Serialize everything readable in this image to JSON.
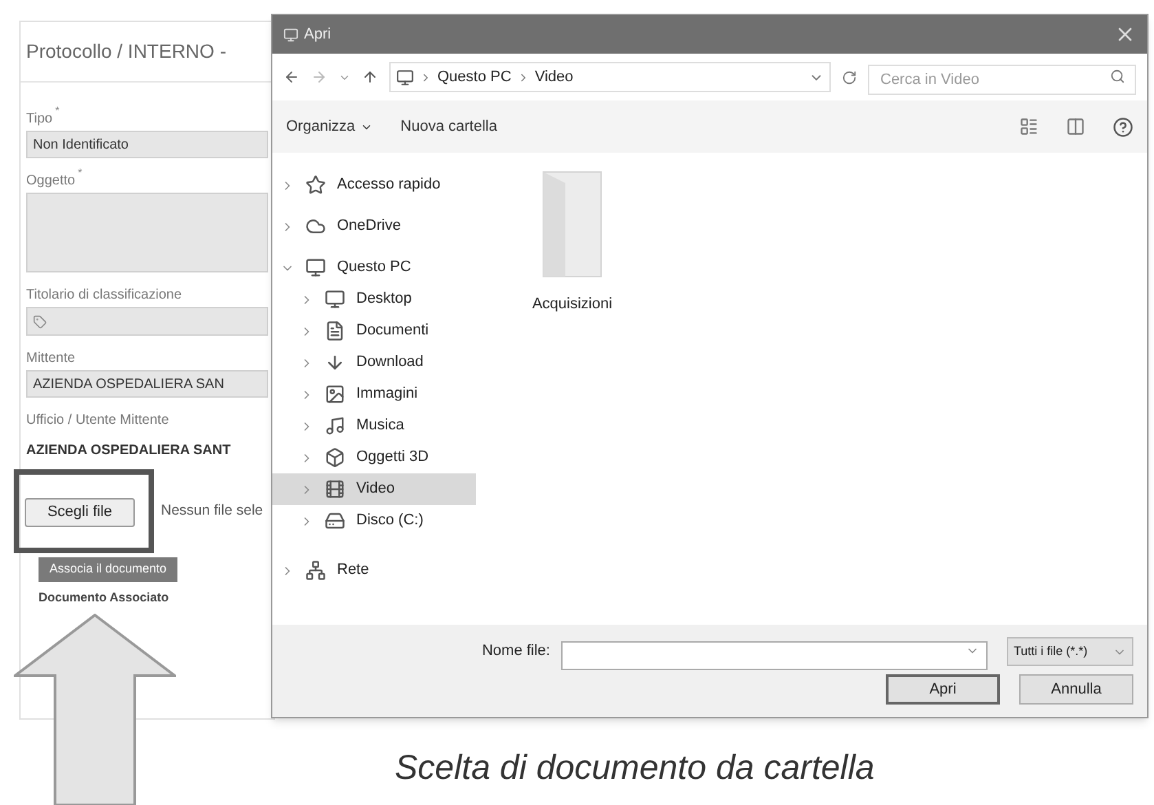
{
  "form": {
    "title": "Protocollo / INTERNO -",
    "fields": [
      {
        "label": "Tipo",
        "marker": "*",
        "kind": "select",
        "value": "Non Identificato"
      },
      {
        "label": "Oggetto",
        "marker": "*",
        "kind": "textarea"
      },
      {
        "label": "Titolario di classificazione",
        "kind": "tag"
      },
      {
        "label": "Mittente",
        "kind": "select",
        "value": "AZIENDA OSPEDALIERA SAN"
      },
      {
        "label": "Ufficio / Utente Mittente",
        "kind": "static",
        "value": "AZIENDA OSPEDALIERA SANT"
      }
    ],
    "file_button": "Scegli file",
    "file_status": "Nessun file sele",
    "associate_button": "Associa il documento",
    "associated_label": "Documento Associato"
  },
  "dialog": {
    "title": "Apri",
    "breadcrumb": [
      "Questo PC",
      "Video"
    ],
    "search": {
      "placeholder": "Cerca in Video"
    },
    "toolbar": {
      "organize": "Organizza",
      "new_folder": "Nuova cartella"
    },
    "nav": [
      {
        "label": "Accesso rapido",
        "kind": "star",
        "expanded": false,
        "selected": false
      },
      {
        "label": "OneDrive",
        "kind": "cloud",
        "expanded": false,
        "selected": false
      },
      {
        "label": "Questo PC",
        "kind": "pc",
        "expanded": true,
        "selected": false,
        "children": [
          {
            "label": "Desktop",
            "kind": "desktop",
            "expanded": false,
            "selected": false
          },
          {
            "label": "Documenti",
            "kind": "documents",
            "expanded": false,
            "selected": false
          },
          {
            "label": "Download",
            "kind": "download",
            "expanded": false,
            "selected": false
          },
          {
            "label": "Immagini",
            "kind": "images",
            "expanded": false,
            "selected": false
          },
          {
            "label": "Musica",
            "kind": "music",
            "expanded": false,
            "selected": false
          },
          {
            "label": "Oggetti 3D",
            "kind": "objects",
            "expanded": false,
            "selected": false
          },
          {
            "label": "Video",
            "kind": "video",
            "expanded": false,
            "selected": true
          },
          {
            "label": "Disco (C:)",
            "kind": "disk",
            "expanded": false,
            "selected": false
          }
        ]
      },
      {
        "label": "Rete",
        "kind": "network",
        "expanded": false,
        "selected": false
      }
    ],
    "files": [
      {
        "name": "Acquisizioni",
        "kind": "folder"
      }
    ],
    "footer": {
      "filename_label": "Nome file:",
      "filter": "Tutti i file (*.*)",
      "buttons": [
        {
          "label": "Apri",
          "default": true
        },
        {
          "label": "Annulla",
          "default": false
        }
      ]
    }
  },
  "caption": "Scelta di documento da cartella"
}
